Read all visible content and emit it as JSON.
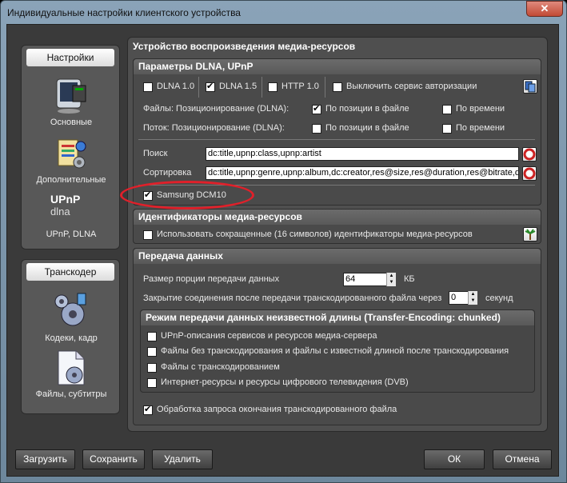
{
  "window": {
    "title": "Индивидуальные настройки клиентского устройства",
    "close_glyph": "✕"
  },
  "sidebar": {
    "settings_header": "Настройки",
    "items": [
      {
        "label": "Основные",
        "icon": "monitor-icon"
      },
      {
        "label": "Дополнительные",
        "icon": "settings-board-icon"
      },
      {
        "label": "UPnP, DLNA",
        "icon": "upnp-dlna-logo-icon"
      }
    ],
    "transcoder_header": "Транскодер",
    "transcoder_items": [
      {
        "label": "Кодеки, кадр",
        "icon": "gears-icon"
      },
      {
        "label": "Файлы, субтитры",
        "icon": "file-gear-icon"
      }
    ],
    "upnp_logo_text": "UPnP",
    "dlna_logo_text": "dlna"
  },
  "main": {
    "title": "Устройство воспроизведения медиа-ресурсов",
    "dlna": {
      "header": "Параметры DLNA, UPnP",
      "dlna10": "DLNA 1.0",
      "dlna15": "DLNA 1.5",
      "http10": "HTTP 1.0",
      "disable_auth": "Выключить сервис авторизации",
      "files_pos_label": "Файлы: Позиционирование (DLNA):",
      "stream_pos_label": "Поток: Позиционирование (DLNA):",
      "by_file_pos": "По позиции в файле",
      "by_time": "По времени",
      "search_label": "Поиск",
      "search_value": "dc:title,upnp:class,upnp:artist",
      "sort_label": "Сортировка",
      "sort_value": "dc:title,upnp:genre,upnp:album,dc:creator,res@size,res@duration,res@bitrate,d",
      "samsung": "Samsung DCM10"
    },
    "ids": {
      "header": "Идентификаторы медиа-ресурсов",
      "short_ids": "Использовать сокращенные (16 символов) идентификаторы медиа-ресурсов"
    },
    "transfer": {
      "header": "Передача данных",
      "chunk_label": "Размер порции передачи данных",
      "chunk_value": "64",
      "chunk_unit": "КБ",
      "close_label": "Закрытие соединения после передачи транскодированного файла через",
      "close_value": "0",
      "close_unit": "секунд",
      "unknown_len_header": "Режим передачи данных неизвестной длины (Transfer-Encoding: chunked)",
      "opt1": "UPnP-описания сервисов и ресурсов медиа-сервера",
      "opt2": "Файлы без транскодирования и файлы с известной длиной после транскодирования",
      "opt3": "Файлы с транскодированием",
      "opt4": "Интернет-ресурсы и ресурсы цифрового телевидения (DVB)",
      "end_request": "Обработка запроса окончания транскодированного файла"
    }
  },
  "buttons": {
    "load": "Загрузить",
    "save": "Сохранить",
    "delete": "Удалить",
    "ok": "ОК",
    "cancel": "Отмена"
  },
  "colors": {
    "highlight": "#e0202a",
    "panel": "#4f4f4f"
  }
}
